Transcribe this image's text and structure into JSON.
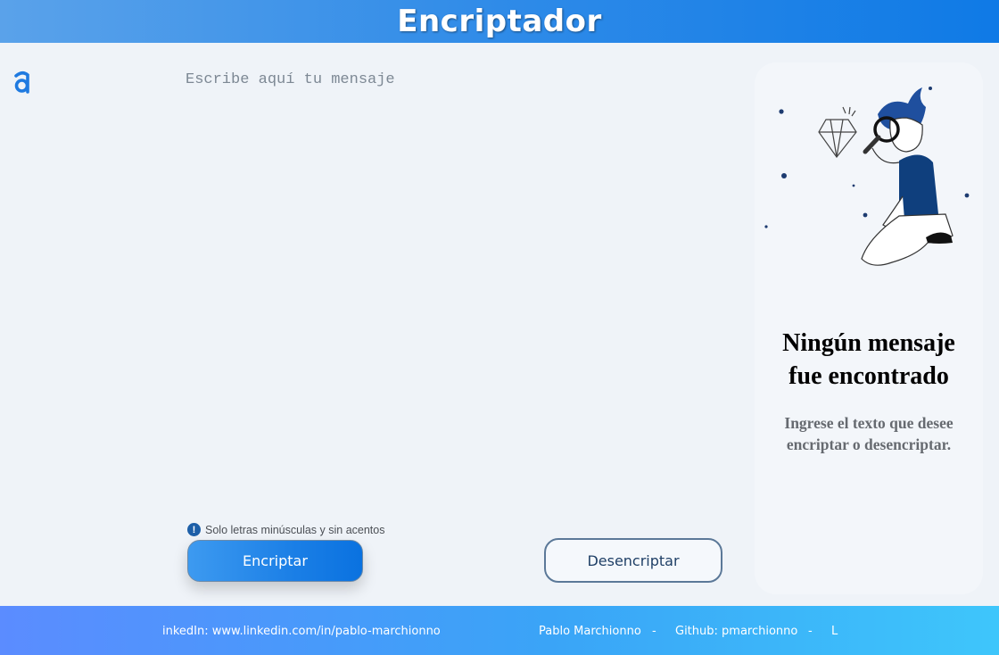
{
  "header": {
    "title": "Encriptador"
  },
  "logo": {
    "icon": "alura-logo-icon",
    "color": "#1f7ae0"
  },
  "input": {
    "placeholder": "Escribe aquí tu mensaje",
    "value": ""
  },
  "hint": {
    "icon": "info-icon",
    "text": "Solo letras minúsculas y sin acentos"
  },
  "buttons": {
    "encrypt": "Encriptar",
    "decrypt": "Desencriptar"
  },
  "result": {
    "illustration": "person-with-magnifier-icon",
    "title_line1": "Ningún mensaje",
    "title_line2": "fue encontrado",
    "subtitle_line1": "Ingrese el texto que desee",
    "subtitle_line2": "encriptar o desencriptar."
  },
  "footer": {
    "linkedin": "inkedIn: www.linkedin.com/in/pablo-marchionno",
    "name": "Pablo Marchionno",
    "sep1": "-",
    "github": "Github: pmarchionno",
    "sep2": "-",
    "tail": "L"
  },
  "colors": {
    "accent": "#1b7fe6",
    "header_start": "#5aa2ea",
    "header_end": "#0f7ae6",
    "footer_start": "#5b8cff",
    "footer_end": "#3ec6fb",
    "outline_button": "#5b7898"
  }
}
